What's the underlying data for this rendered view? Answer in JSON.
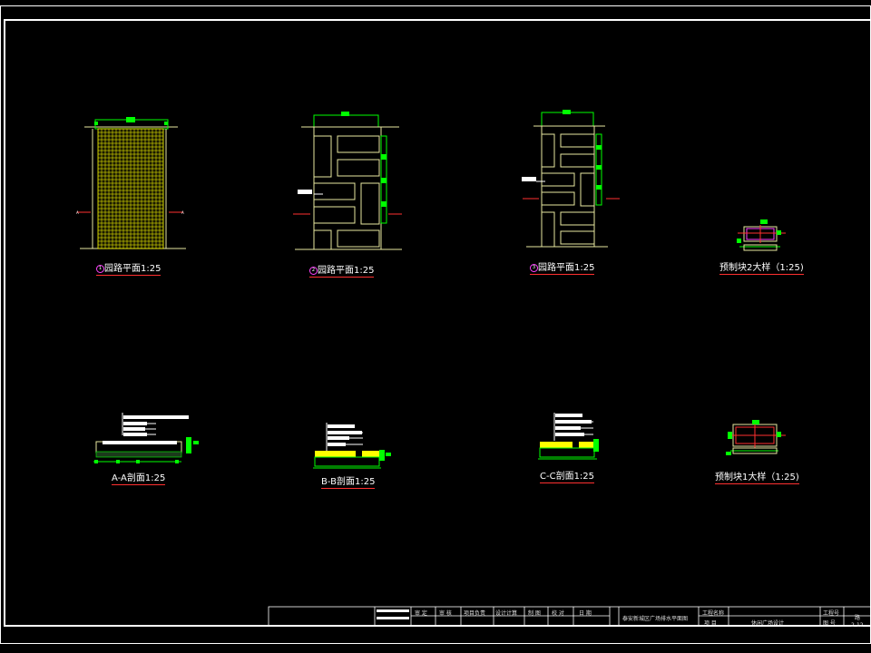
{
  "drawing": {
    "views": [
      {
        "id": "plan1",
        "label": "园路平面1:25",
        "marker": "1"
      },
      {
        "id": "plan2",
        "label": "园路平面1:25",
        "marker": "2"
      },
      {
        "id": "plan3",
        "label": "园路平面1:25",
        "marker": "3"
      },
      {
        "id": "block2",
        "label": "预制块2大样（1:25)"
      },
      {
        "id": "secA",
        "label": "A-A剖面1:25"
      },
      {
        "id": "secB",
        "label": "B-B剖面1:25"
      },
      {
        "id": "secC",
        "label": "C-C剖面1:25"
      },
      {
        "id": "block1",
        "label": "预制块1大样（1:25)"
      }
    ]
  },
  "titleblock": {
    "headers": [
      "审 定",
      "审 核",
      "项目负责",
      "设计计算",
      "制 图",
      "校 对",
      "日 期"
    ],
    "project_title": "泰安新城区广场排水平面图",
    "field_engineering": "工程名称",
    "field_item": "项 目",
    "item_value": "休闲广场设计",
    "field_project_no": "工程号",
    "field_sheet_no": "图 号",
    "sheet_prefix": "路",
    "sheet_no": "2-12"
  },
  "colors": {
    "frame": "#ffffff",
    "line": "#e8e8a0",
    "dim": "#00ff00",
    "yellow": "#ffff00",
    "red": "#ff3030",
    "magenta": "#ff40ff"
  }
}
